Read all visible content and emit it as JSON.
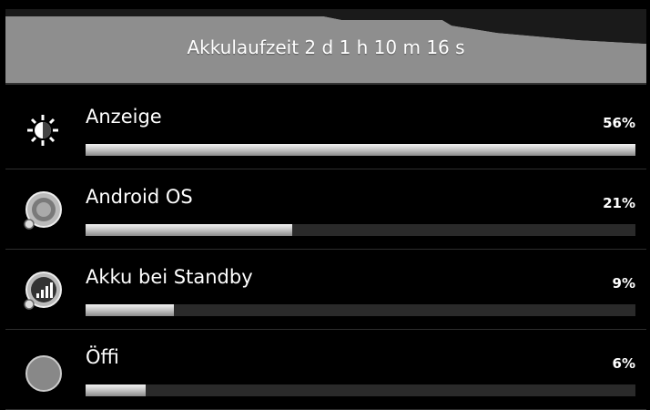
{
  "header": {
    "title": "Akkulaufzeit 2 d 1 h 10 m 16 s"
  },
  "items": [
    {
      "name": "Anzeige",
      "percent_label": "56%",
      "percent": 56,
      "bar_fraction": 1.0,
      "icon": "brightness-icon"
    },
    {
      "name": "Android OS",
      "percent_label": "21%",
      "percent": 21,
      "bar_fraction": 0.375,
      "icon": "android-os-icon"
    },
    {
      "name": "Akku bei Standby",
      "percent_label": "9%",
      "percent": 9,
      "bar_fraction": 0.16,
      "icon": "standby-signal-icon"
    },
    {
      "name": "Öffi",
      "percent_label": "6%",
      "percent": 6,
      "bar_fraction": 0.11,
      "icon": "app-icon"
    }
  ]
}
